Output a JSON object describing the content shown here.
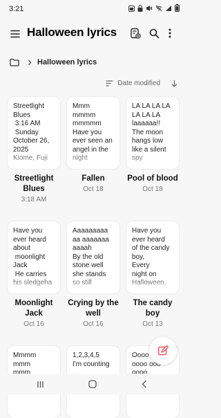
{
  "status": {
    "time": "3:21"
  },
  "header": {
    "title": "Halloween lyrics"
  },
  "breadcrumb": {
    "current": "Halloween lyrics"
  },
  "sort": {
    "label": "Date modified"
  },
  "notes": [
    {
      "preview": "Streetlight\nBlues\n 3:16 AM\n Sunday\nOctober 26,\n2025\nKiome, Fuji",
      "title": "Streetlight Blues",
      "date": "3:18 AM"
    },
    {
      "preview": "Mmm\nmmmm\nmmmmm\nHave you\never seen an\nangel in the\nnight",
      "title": "Fallen",
      "date": "Oct 18"
    },
    {
      "preview": "LA LA LA LA\nLA LA LA\nlaaaaaa!!\nThe moon\nhangs low\nlike a silent\nspy",
      "title": "Pool of blood",
      "date": "Oct 18"
    },
    {
      "preview": "Have you\never heard\nabout\n moonlight\nJack\n He carries\nhis sledgeha",
      "title": "Moonlight Jack",
      "date": "Oct 16"
    },
    {
      "preview": "Aaaaaaaaa\naa aaaaaaa\naaaah\nBy the old\nstone well\nshe stands\nso still",
      "title": "Crying by the well",
      "date": "Oct 16"
    },
    {
      "preview": "Have you\never heard\nof the candy\nboy,\nEvery\nnight on\nHalloween,",
      "title": "The candy boy",
      "date": "Oct 13"
    },
    {
      "preview": "Mmmm\nmmm\nmmm",
      "title": "",
      "date": ""
    },
    {
      "preview": "1,2,3,4,5\nI'm counting\n...",
      "title": "",
      "date": ""
    },
    {
      "preview": "Oooo\noooo ooo\noooo",
      "title": "",
      "date": ""
    }
  ],
  "colors": {
    "accent": "#e8505b",
    "background": "#f7f7f7",
    "card": "#ffffff"
  }
}
